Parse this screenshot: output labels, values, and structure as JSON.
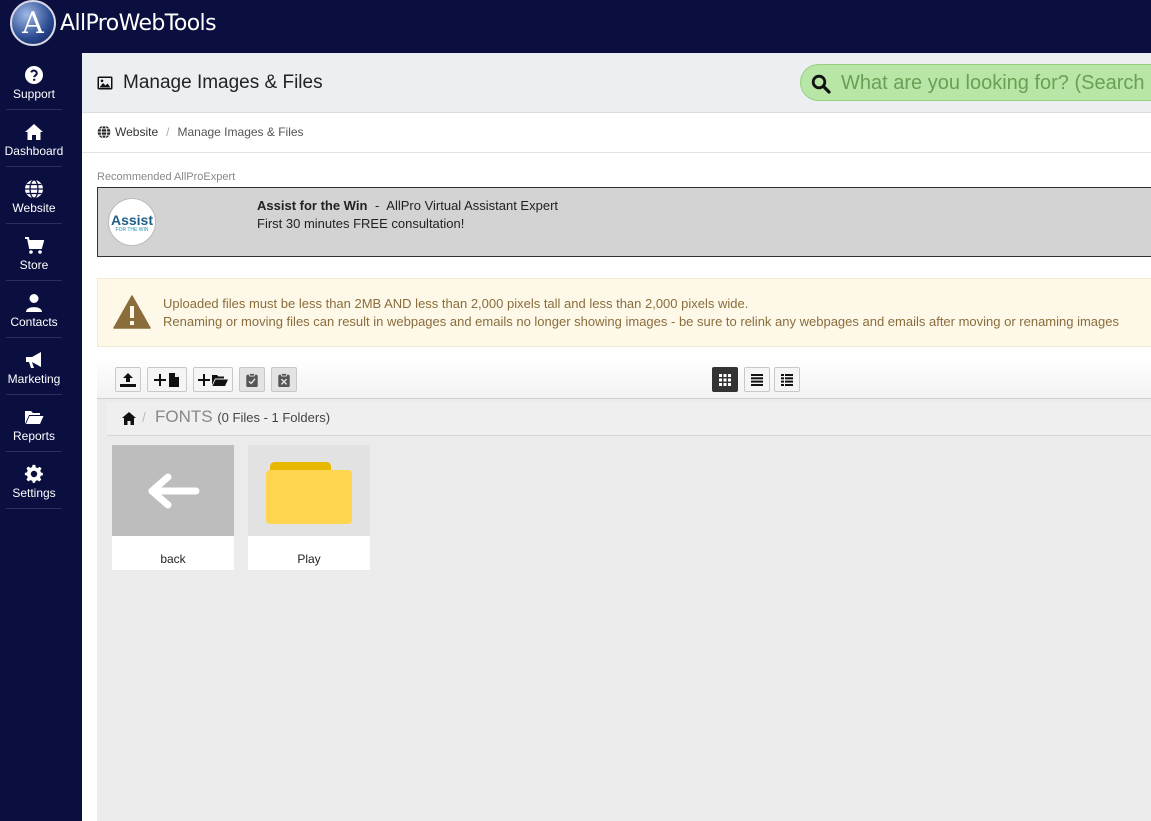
{
  "app": {
    "brand_name": "AllProWebTools",
    "logo_letter": "A"
  },
  "sidebar": {
    "items": [
      {
        "label": "Support",
        "icon": "question-circle-icon"
      },
      {
        "label": "Dashboard",
        "icon": "home-icon"
      },
      {
        "label": "Website",
        "icon": "globe-icon"
      },
      {
        "label": "Store",
        "icon": "shopping-cart-icon"
      },
      {
        "label": "Contacts",
        "icon": "user-icon"
      },
      {
        "label": "Marketing",
        "icon": "megaphone-icon"
      },
      {
        "label": "Reports",
        "icon": "folder-open-icon"
      },
      {
        "label": "Settings",
        "icon": "gear-icon"
      }
    ]
  },
  "header": {
    "title": "Manage Images & Files",
    "title_icon": "image-icon",
    "search_placeholder": "What are you looking for? (Search"
  },
  "breadcrumb": {
    "items": [
      "Website",
      "Manage Images & Files"
    ]
  },
  "recommended": {
    "label": "Recommended AllProExpert",
    "logo_text": "Assist",
    "logo_subtext": "FOR THE WIN",
    "name": "Assist for the Win",
    "separator": "-",
    "role": "AllPro Virtual Assistant Expert",
    "offer": "First 30 minutes FREE consultation!"
  },
  "warning": {
    "line1": "Uploaded files must be less than 2MB AND less than 2,000 pixels tall and less than 2,000 pixels wide.",
    "line2": "Renaming or moving files can result in webpages and emails no longer showing images - be sure to relink any webpages and emails after moving or renaming images"
  },
  "file_manager": {
    "toolbar": {
      "actions": [
        "upload-icon",
        "new-file-icon",
        "new-folder-icon",
        "paste-icon",
        "clear-clipboard-icon"
      ],
      "views": [
        "grid-view-icon",
        "list-view-icon",
        "detail-view-icon"
      ],
      "active_view": "grid-view-icon"
    },
    "path": {
      "folder": "FONTS",
      "count": "(0 Files - 1 Folders)"
    },
    "items": [
      {
        "name": "back",
        "type": "back"
      },
      {
        "name": "Play",
        "type": "folder"
      }
    ]
  },
  "colors": {
    "nav_bg": "#0b0f3f",
    "search_bg": "#b7e6a6",
    "warning_text": "#8a6d3b",
    "folder_yellow": "#ffd54f"
  }
}
